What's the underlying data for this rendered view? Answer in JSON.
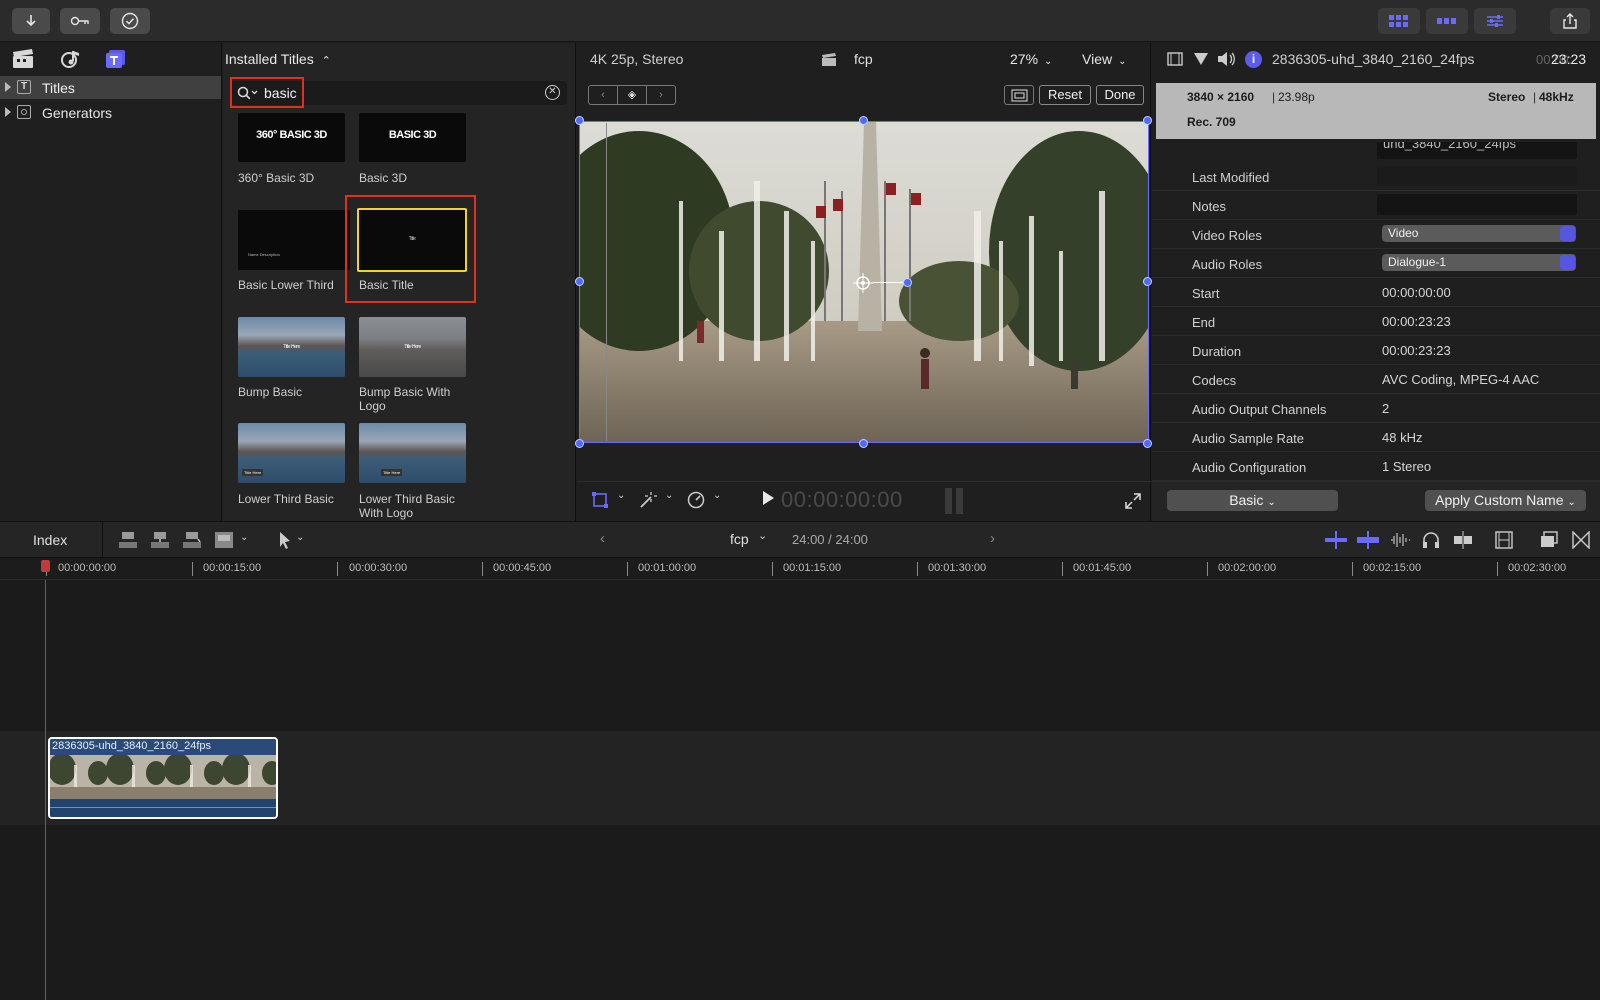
{
  "browser": {
    "header": "Installed Titles",
    "search_value": "basic",
    "sidebar_items": [
      {
        "label": "Titles",
        "selected": true
      },
      {
        "label": "Generators",
        "selected": false
      }
    ],
    "tiles": [
      {
        "label": "360° Basic 3D",
        "thumb_text": "360° BASIC 3D"
      },
      {
        "label": "Basic 3D",
        "thumb_text": "BASIC 3D"
      },
      {
        "label": "Basic Lower Third",
        "thumb_text": "Name Description"
      },
      {
        "label": "Basic Title",
        "thumb_text": "Title",
        "selected": true
      },
      {
        "label": "Bump Basic",
        "thumb_text": "Title Here"
      },
      {
        "label": "Bump Basic With Logo",
        "thumb_text": "Title Here"
      },
      {
        "label": "Lower Third Basic",
        "thumb_text": "Title Here"
      },
      {
        "label": "Lower Third Basic With Logo",
        "thumb_text": "Title Here"
      }
    ]
  },
  "viewer": {
    "format": "4K 25p, Stereo",
    "project": "fcp",
    "zoom": "27%",
    "view_label": "View",
    "reset_label": "Reset",
    "done_label": "Done",
    "timecode": "00:00:00:00"
  },
  "inspector": {
    "clip_name": "2836305-uhd_3840_2160_24fps",
    "duration_dim": "00:00:",
    "duration": "23:23",
    "resolution": "3840 × 2160",
    "framerate": "23.98p",
    "audio_format": "Stereo",
    "sample_rate": "48kHz",
    "colorspace": "Rec. 709",
    "name_field": "uhd_3840_2160_24fps",
    "rows": [
      {
        "label": "Last Modified",
        "value": ""
      },
      {
        "label": "Notes",
        "value": ""
      },
      {
        "label": "Video Roles",
        "value": "Video"
      },
      {
        "label": "Audio Roles",
        "value": "Dialogue-1"
      },
      {
        "label": "Start",
        "value": "00:00:00:00"
      },
      {
        "label": "End",
        "value": "00:00:23:23"
      },
      {
        "label": "Duration",
        "value": "00:00:23:23"
      },
      {
        "label": "Codecs",
        "value": "AVC Coding, MPEG-4 AAC"
      },
      {
        "label": "Audio Output Channels",
        "value": "2"
      },
      {
        "label": "Audio Sample Rate",
        "value": "48 kHz"
      },
      {
        "label": "Audio Configuration",
        "value": "1 Stereo"
      }
    ],
    "metadata_view": "Basic",
    "apply_label": "Apply Custom Name"
  },
  "timeline": {
    "index_label": "Index",
    "project": "fcp",
    "position": "24:00 / 24:00",
    "ruler_labels": [
      "00:00:00:00",
      "00:00:15:00",
      "00:00:30:00",
      "00:00:45:00",
      "00:01:00:00",
      "00:01:15:00",
      "00:01:30:00",
      "00:01:45:00",
      "00:02:00:00",
      "00:02:15:00",
      "00:02:30:00"
    ],
    "clip_name": "2836305-uhd_3840_2160_24fps"
  },
  "colors": {
    "accent": "#5b5bf0",
    "highlight": "#e0301e",
    "selection": "#f2d32b"
  }
}
